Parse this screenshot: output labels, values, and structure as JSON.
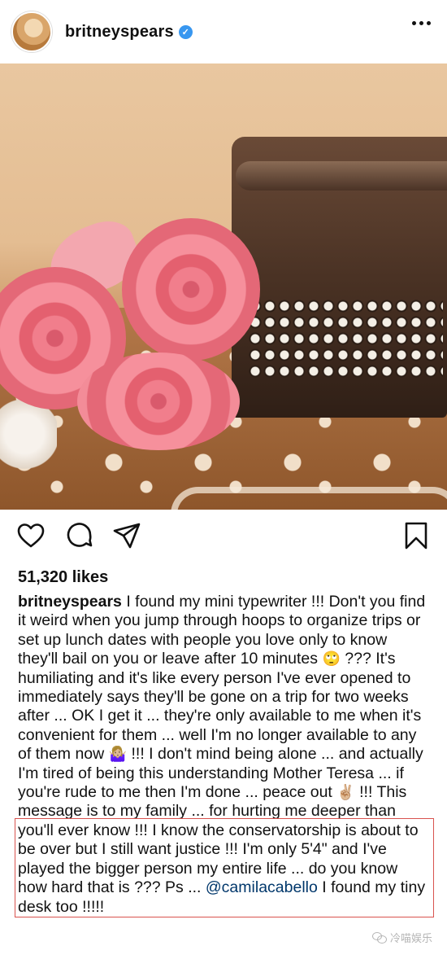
{
  "header": {
    "username": "britneyspears",
    "verified_icon": "verified-badge-icon",
    "more_icon": "more-options-icon"
  },
  "post": {
    "likes": "51,320 likes",
    "caption_username": "britneyspears",
    "caption_part1": " I found my mini typewriter !!! Don't you find it weird when you jump through hoops to organize trips or set up lunch dates with people you love only to know they'll bail on you or leave after 10 minutes ",
    "emoji1": "🙄",
    "caption_part2": " ??? It's humiliating and it's like every person I've ever opened to immediately says they'll be gone on a trip for two weeks after ... OK I get it ... they're only available to me when it's convenient for them ... well I'm no longer available to any of them now ",
    "emoji2": "🤷🏼‍♀️",
    "caption_part3": " !!! I don't mind being alone ... and actually I'm tired of being this understanding Mother Teresa ... if you're rude to me then I'm done ... peace out ",
    "emoji3": "✌🏼",
    "caption_part4": " !!! This message is to my family ... for hurting me deeper than you'll ever know !!! I know the conservatorship is about to be over but I still want justice !!! I'm only 5'4\" and I've played the bigger person my entire life ... do you know how hard that is ??? Ps ... ",
    "mention": "@camilacabello",
    "caption_part5": " I found my tiny desk too !!!!!"
  },
  "actions": {
    "like_icon": "heart-icon",
    "comment_icon": "comment-icon",
    "share_icon": "send-icon",
    "save_icon": "bookmark-icon"
  },
  "watermark": {
    "text": "冷喵娱乐"
  },
  "colors": {
    "verified": "#3897f0",
    "mention": "#00376b",
    "highlight": "#d9534f"
  }
}
